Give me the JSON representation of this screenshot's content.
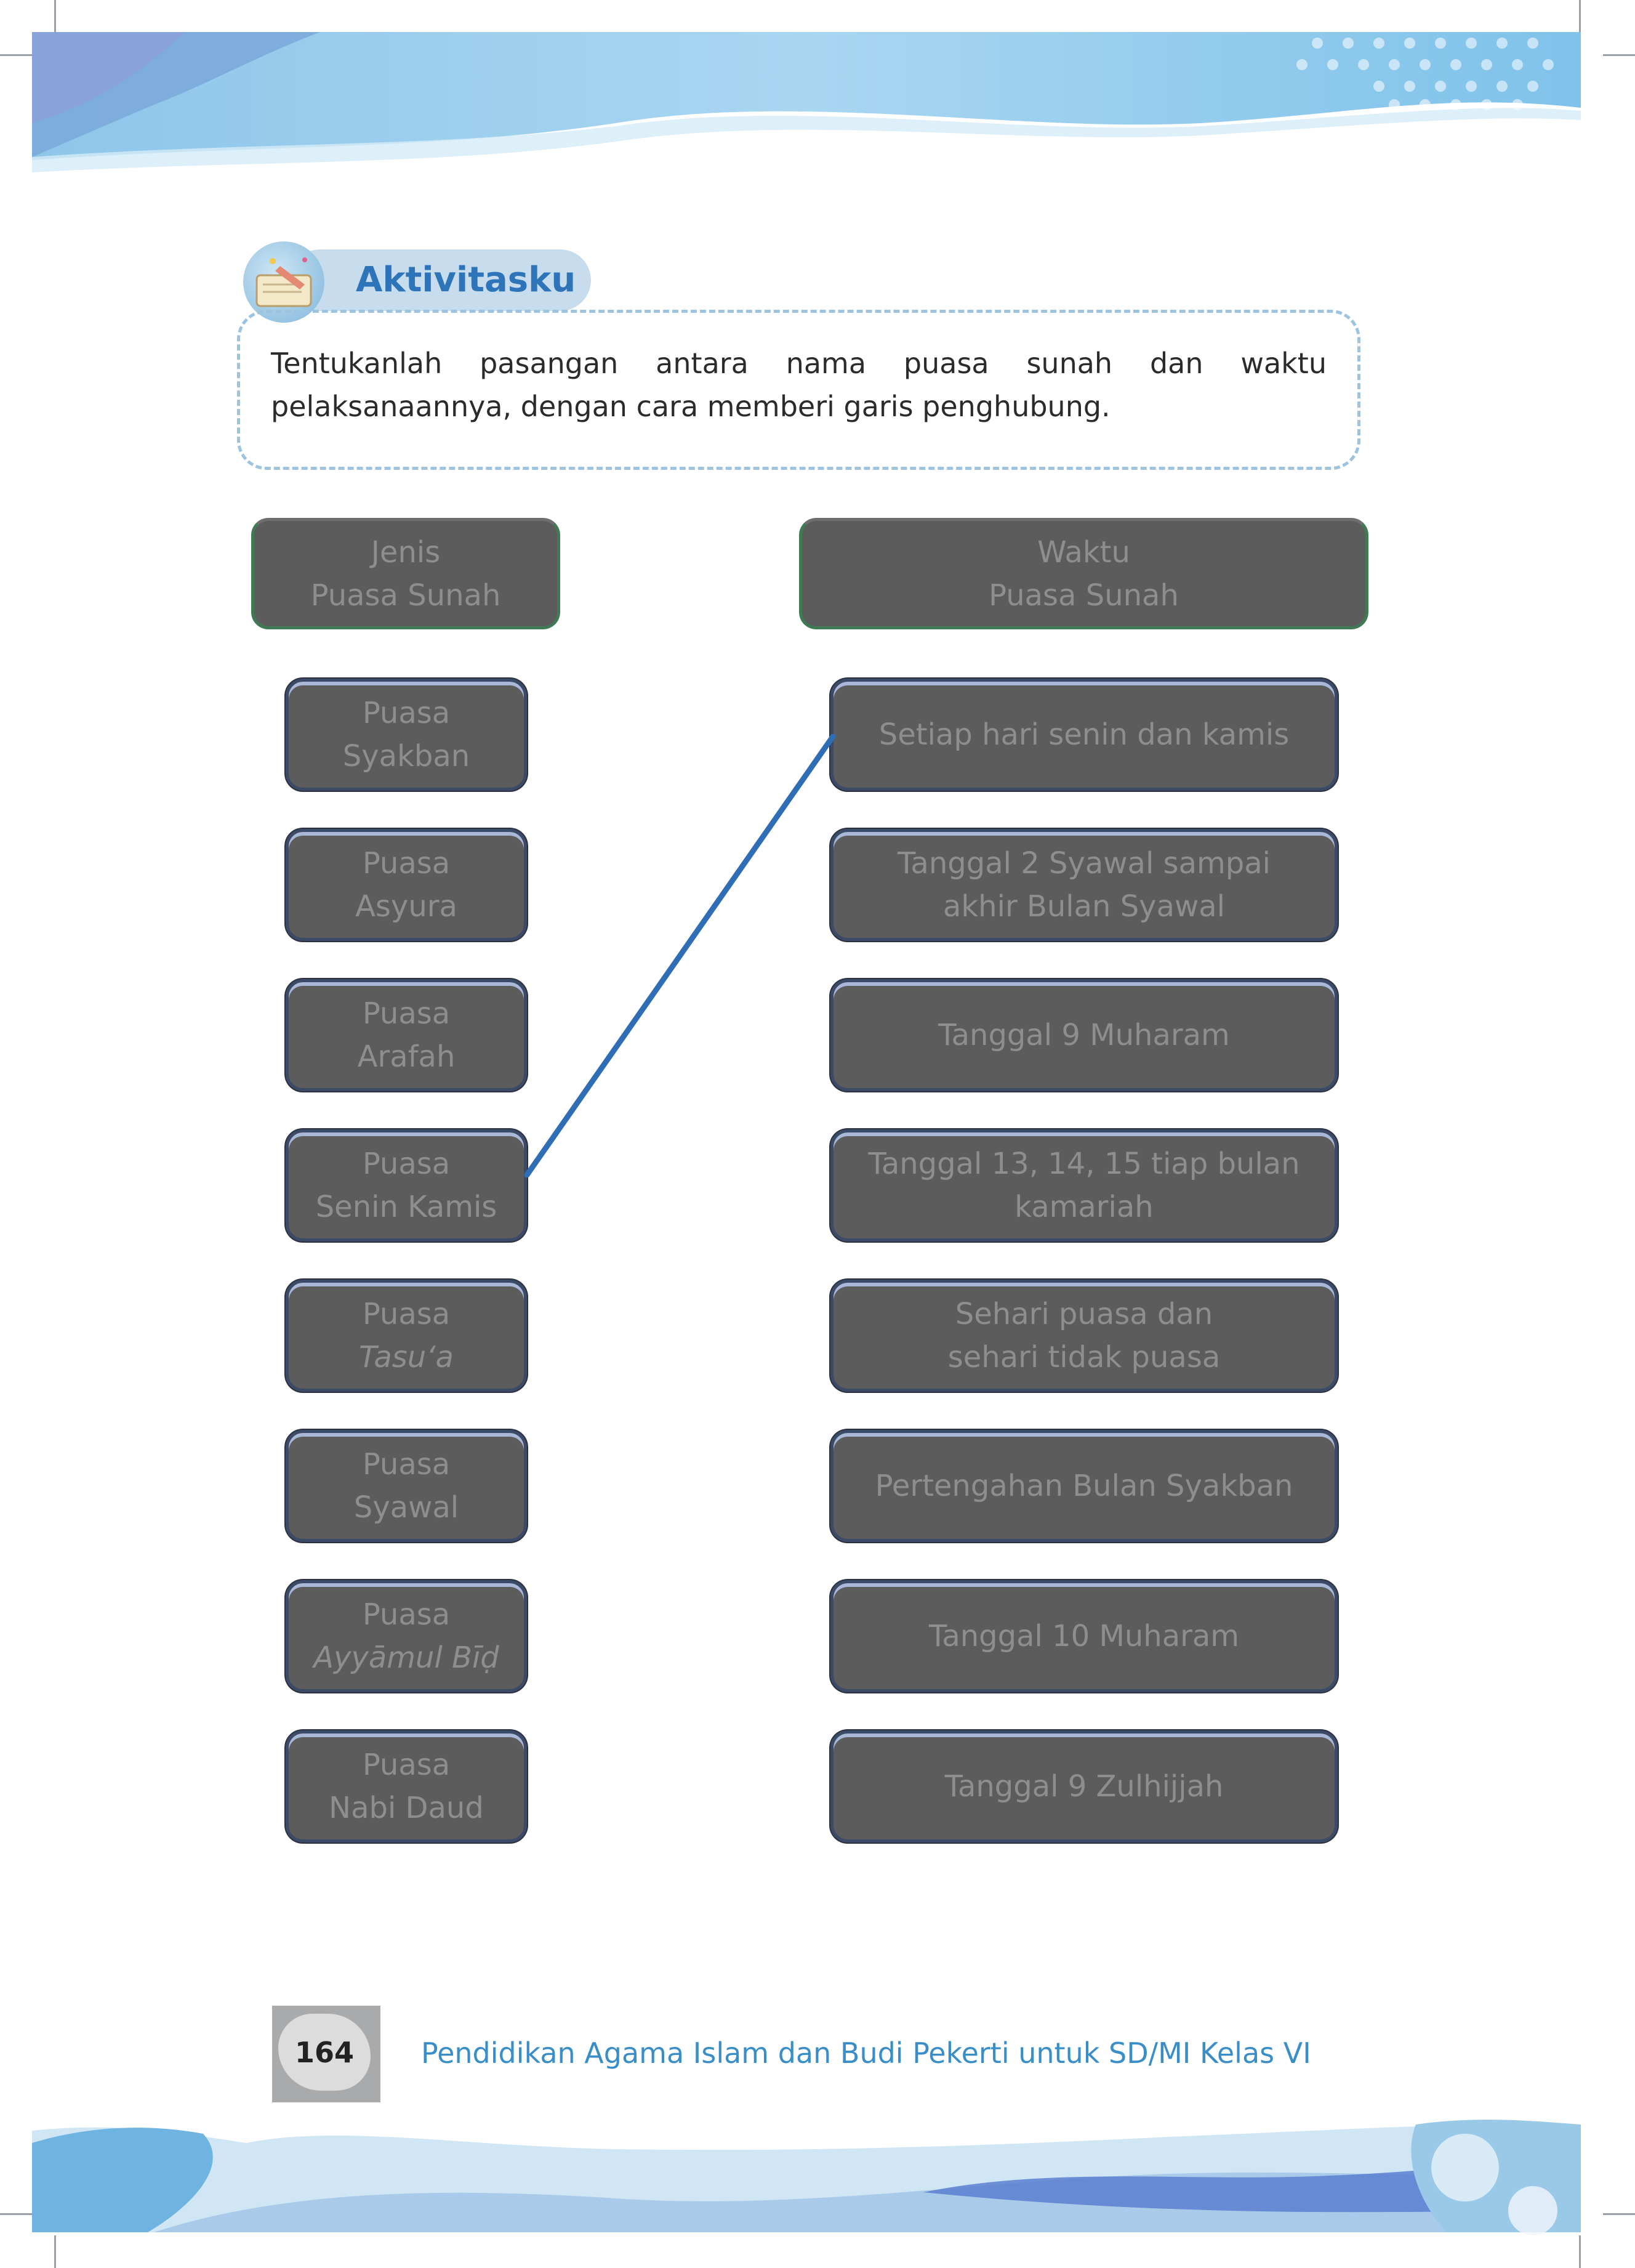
{
  "activity": {
    "title": "Aktivitasku",
    "instruction": "Tentukanlah pasangan antara nama puasa sunah dan waktu pelaksanaannya, dengan cara memberi garis penghubung."
  },
  "headers": {
    "left": {
      "line1": "Jenis",
      "line2": "Puasa Sunah"
    },
    "right": {
      "line1": "Waktu",
      "line2": "Puasa Sunah"
    }
  },
  "left_items": [
    {
      "line1": "Puasa",
      "line2": "Syakban"
    },
    {
      "line1": "Puasa",
      "line2": "Asyura"
    },
    {
      "line1": "Puasa",
      "line2": "Arafah"
    },
    {
      "line1": "Puasa",
      "line2": "Senin Kamis"
    },
    {
      "line1": "Puasa",
      "line2": "Tasu‘a"
    },
    {
      "line1": "Puasa",
      "line2": "Syawal"
    },
    {
      "line1": "Puasa",
      "line2": "Ayyāmul Bīḍ"
    },
    {
      "line1": "Puasa",
      "line2": "Nabi Daud"
    }
  ],
  "right_items": [
    {
      "line1": "Setiap hari senin dan kamis",
      "line2": ""
    },
    {
      "line1": "Tanggal 2 Syawal sampai",
      "line2": "akhir Bulan Syawal"
    },
    {
      "line1": "Tanggal 9 Muharam",
      "line2": ""
    },
    {
      "line1": "Tanggal 13, 14, 15 tiap bulan",
      "line2": "kamariah"
    },
    {
      "line1": "Sehari puasa dan",
      "line2": "sehari tidak puasa"
    },
    {
      "line1": "Pertengahan Bulan Syakban",
      "line2": ""
    },
    {
      "line1": "Tanggal 10 Muharam",
      "line2": ""
    },
    {
      "line1": "Tanggal 9 Zulhijjah",
      "line2": ""
    }
  ],
  "footer": {
    "page_number": "164",
    "book_title": "Pendidikan Agama Islam dan Budi Pekerti untuk SD/MI Kelas VI"
  },
  "colors": {
    "accent": "#2d74b8",
    "connector_line": "#2f6db5",
    "box_fill": "#5c5c5c"
  }
}
